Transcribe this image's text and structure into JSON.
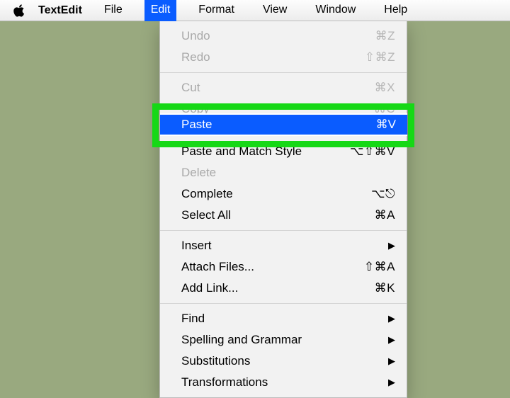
{
  "menubar": {
    "app_name": "TextEdit",
    "items": [
      "File",
      "Edit",
      "Format",
      "View",
      "Window",
      "Help"
    ],
    "open_index": 1
  },
  "highlight": {
    "label": "Paste",
    "shortcut": "⌘V"
  },
  "dropdown": {
    "rows": [
      {
        "label": "Undo",
        "shortcut": "⌘Z",
        "disabled": true
      },
      {
        "label": "Redo",
        "shortcut": "⇧⌘Z",
        "disabled": true
      },
      {
        "sep": true
      },
      {
        "label": "Cut",
        "shortcut": "⌘X",
        "disabled": true
      },
      {
        "label": "Copy",
        "shortcut": "⌘C",
        "disabled": true
      },
      {
        "label": "Paste",
        "shortcut": "⌘V",
        "selected": true
      },
      {
        "label": "Paste and Match Style",
        "shortcut": "⌥⇧⌘V"
      },
      {
        "label": "Delete",
        "disabled": true
      },
      {
        "label": "Complete",
        "shortcut": "⌥⎋"
      },
      {
        "label": "Select All",
        "shortcut": "⌘A"
      },
      {
        "sep": true
      },
      {
        "label": "Insert",
        "submenu": true
      },
      {
        "label": "Attach Files...",
        "shortcut": "⇧⌘A"
      },
      {
        "label": "Add Link...",
        "shortcut": "⌘K"
      },
      {
        "sep": true
      },
      {
        "label": "Find",
        "submenu": true
      },
      {
        "label": "Spelling and Grammar",
        "submenu": true
      },
      {
        "label": "Substitutions",
        "submenu": true
      },
      {
        "label": "Transformations",
        "submenu": true
      }
    ]
  }
}
